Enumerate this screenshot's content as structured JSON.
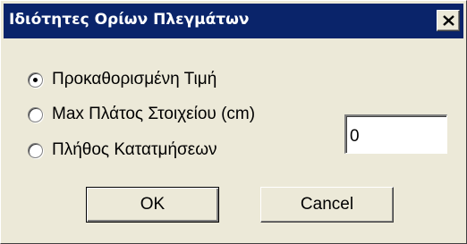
{
  "window": {
    "title": "Ιδιότητες Ορίων Πλεγμάτων"
  },
  "options": [
    {
      "label": "Προκαθορισμένη Τιμή",
      "selected": true
    },
    {
      "label": "Max Πλάτος Στοιχείου (cm)",
      "selected": false
    },
    {
      "label": "Πλήθος Κατατμήσεων",
      "selected": false
    }
  ],
  "value_field": {
    "value": "0"
  },
  "buttons": {
    "ok_label": "OK",
    "cancel_label": "Cancel"
  },
  "icons": {
    "close": "close-icon"
  },
  "colors": {
    "titlebar": "#0a246a",
    "title_text": "#ffffff",
    "dialog_bg": "#ece9d8"
  }
}
